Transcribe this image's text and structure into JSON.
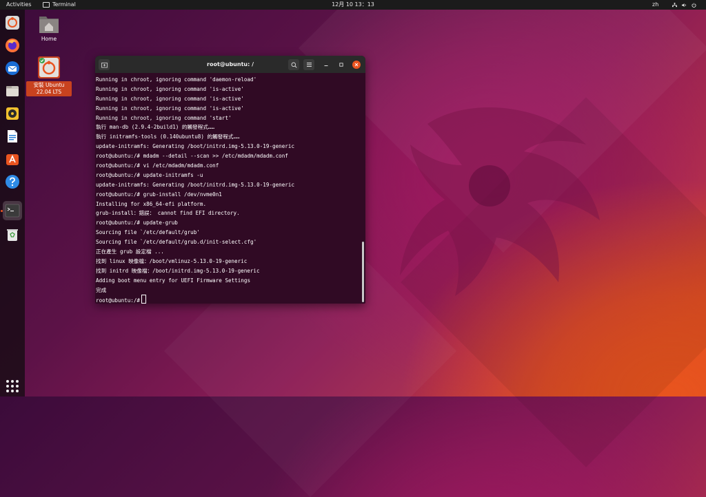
{
  "topbar": {
    "activities": "Activities",
    "app_name": "Terminal",
    "clock": "12月 10 13：13",
    "input_method": "zh"
  },
  "desktop": {
    "home_label": "Home",
    "installer_label": "安裝 Ubuntu 22.04 LTS"
  },
  "dock": {
    "items": [
      "installer",
      "firefox",
      "thunderbird",
      "files",
      "rhythmbox",
      "libreoffice-writer",
      "software",
      "help",
      "terminal",
      "trash"
    ],
    "active": "terminal"
  },
  "terminal": {
    "title": "root@ubuntu: /",
    "lines": [
      "Running in chroot, ignoring command 'daemon-reload'",
      "Running in chroot, ignoring command 'is-active'",
      "Running in chroot, ignoring command 'is-active'",
      "Running in chroot, ignoring command 'is-active'",
      "Running in chroot, ignoring command 'start'",
      "執行 man-db (2.9.4-2build1) 的觸發程式……",
      "執行 initramfs-tools (0.140ubuntu8) 的觸發程式……",
      "update-initramfs: Generating /boot/initrd.img-5.13.0-19-generic",
      "root@ubuntu:/# mdadm --detail --scan >> /etc/mdadm/mdadm.conf",
      "root@ubuntu:/# vi /etc/mdadm/mdadm.conf",
      "root@ubuntu:/# update-initramfs -u",
      "update-initramfs: Generating /boot/initrd.img-5.13.0-19-generic",
      "root@ubuntu:/# grub-install /dev/nvme0n1",
      "Installing for x86_64-efi platform.",
      "grub-install：錯誤： cannot find EFI directory.",
      "root@ubuntu:/# update-grub",
      "Sourcing file `/etc/default/grub'",
      "Sourcing file `/etc/default/grub.d/init-select.cfg'",
      "正在產生 grub 設定檔 ...",
      "找到 linux 映像檔：/boot/vmlinuz-5.13.0-19-generic",
      "找到 initrd 映像檔：/boot/initrd.img-5.13.0-19-generic",
      "Adding boot menu entry for UEFI Firmware Settings",
      "完成"
    ],
    "prompt": "root@ubuntu:/#"
  },
  "colors": {
    "terminal_bg": "#300a24",
    "accent": "#e95420",
    "titlebar": "#2a2a2a"
  }
}
